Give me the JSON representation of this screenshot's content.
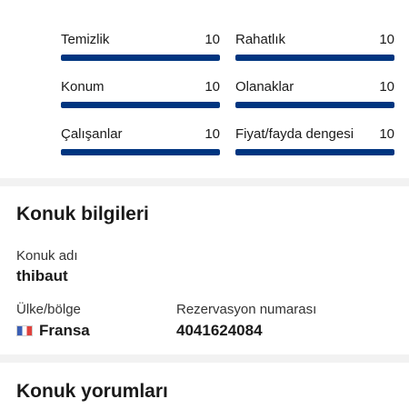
{
  "ratings": [
    {
      "label": "Temizlik",
      "score": "10",
      "fill": 1.0
    },
    {
      "label": "Rahatlık",
      "score": "10",
      "fill": 1.0
    },
    {
      "label": "Konum",
      "score": "10",
      "fill": 1.0
    },
    {
      "label": "Olanaklar",
      "score": "10",
      "fill": 1.0
    },
    {
      "label": "Çalışanlar",
      "score": "10",
      "fill": 1.0
    },
    {
      "label": "Fiyat/fayda dengesi",
      "score": "10",
      "fill": 1.0
    }
  ],
  "guest_info": {
    "title": "Konuk bilgileri",
    "name_label": "Konuk adı",
    "name_value": "thibaut",
    "country_label": "Ülke/bölge",
    "country_value": "Fransa",
    "country_flag_icon": "france-flag-icon",
    "reservation_label": "Rezervasyon numarası",
    "reservation_value": "4041624084"
  },
  "reviews": {
    "title": "Konuk yorumları"
  },
  "colors": {
    "bar_fill": "#003580",
    "divider": "#f2f2f2"
  }
}
